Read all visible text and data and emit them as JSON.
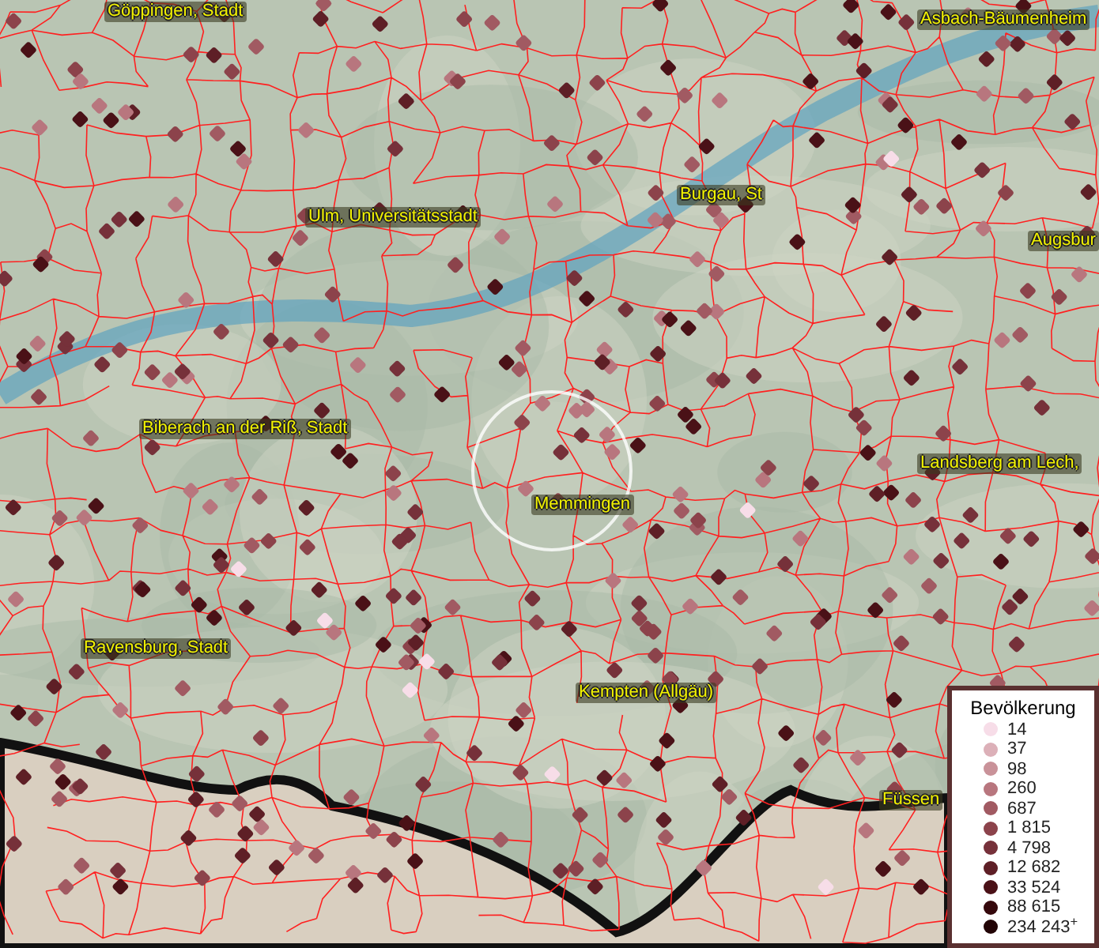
{
  "map": {
    "places": [
      {
        "name": "Göppingen, Stadt"
      },
      {
        "name": "Asbach-Bäumenheim"
      },
      {
        "name": "Ulm, Universitätsstadt"
      },
      {
        "name": "Burgau, St"
      },
      {
        "name": "Augsbur"
      },
      {
        "name": "Biberach an der Riß, Stadt"
      },
      {
        "name": "Landsberg am Lech,"
      },
      {
        "name": "Memmingen"
      },
      {
        "name": "Ravensburg, Stadt"
      },
      {
        "name": "Kempten (Allgäu)"
      },
      {
        "name": "Füssen"
      }
    ]
  },
  "legend": {
    "title": "Bevölkerung",
    "items": [
      {
        "label": "14",
        "color": "#f7dde8"
      },
      {
        "label": "37",
        "color": "#dcb0b8"
      },
      {
        "label": "98",
        "color": "#c99299"
      },
      {
        "label": "260",
        "color": "#b8767e"
      },
      {
        "label": "687",
        "color": "#a15a62"
      },
      {
        "label": "1 815",
        "color": "#8c434b"
      },
      {
        "label": "4 798",
        "color": "#76313a"
      },
      {
        "label": "12 682",
        "color": "#5e1f26"
      },
      {
        "label": "33 524",
        "color": "#4a1117"
      },
      {
        "label": "88 615",
        "color": "#35080c"
      },
      {
        "label": "234 243$^{+}$",
        "color": "#220406"
      }
    ]
  }
}
